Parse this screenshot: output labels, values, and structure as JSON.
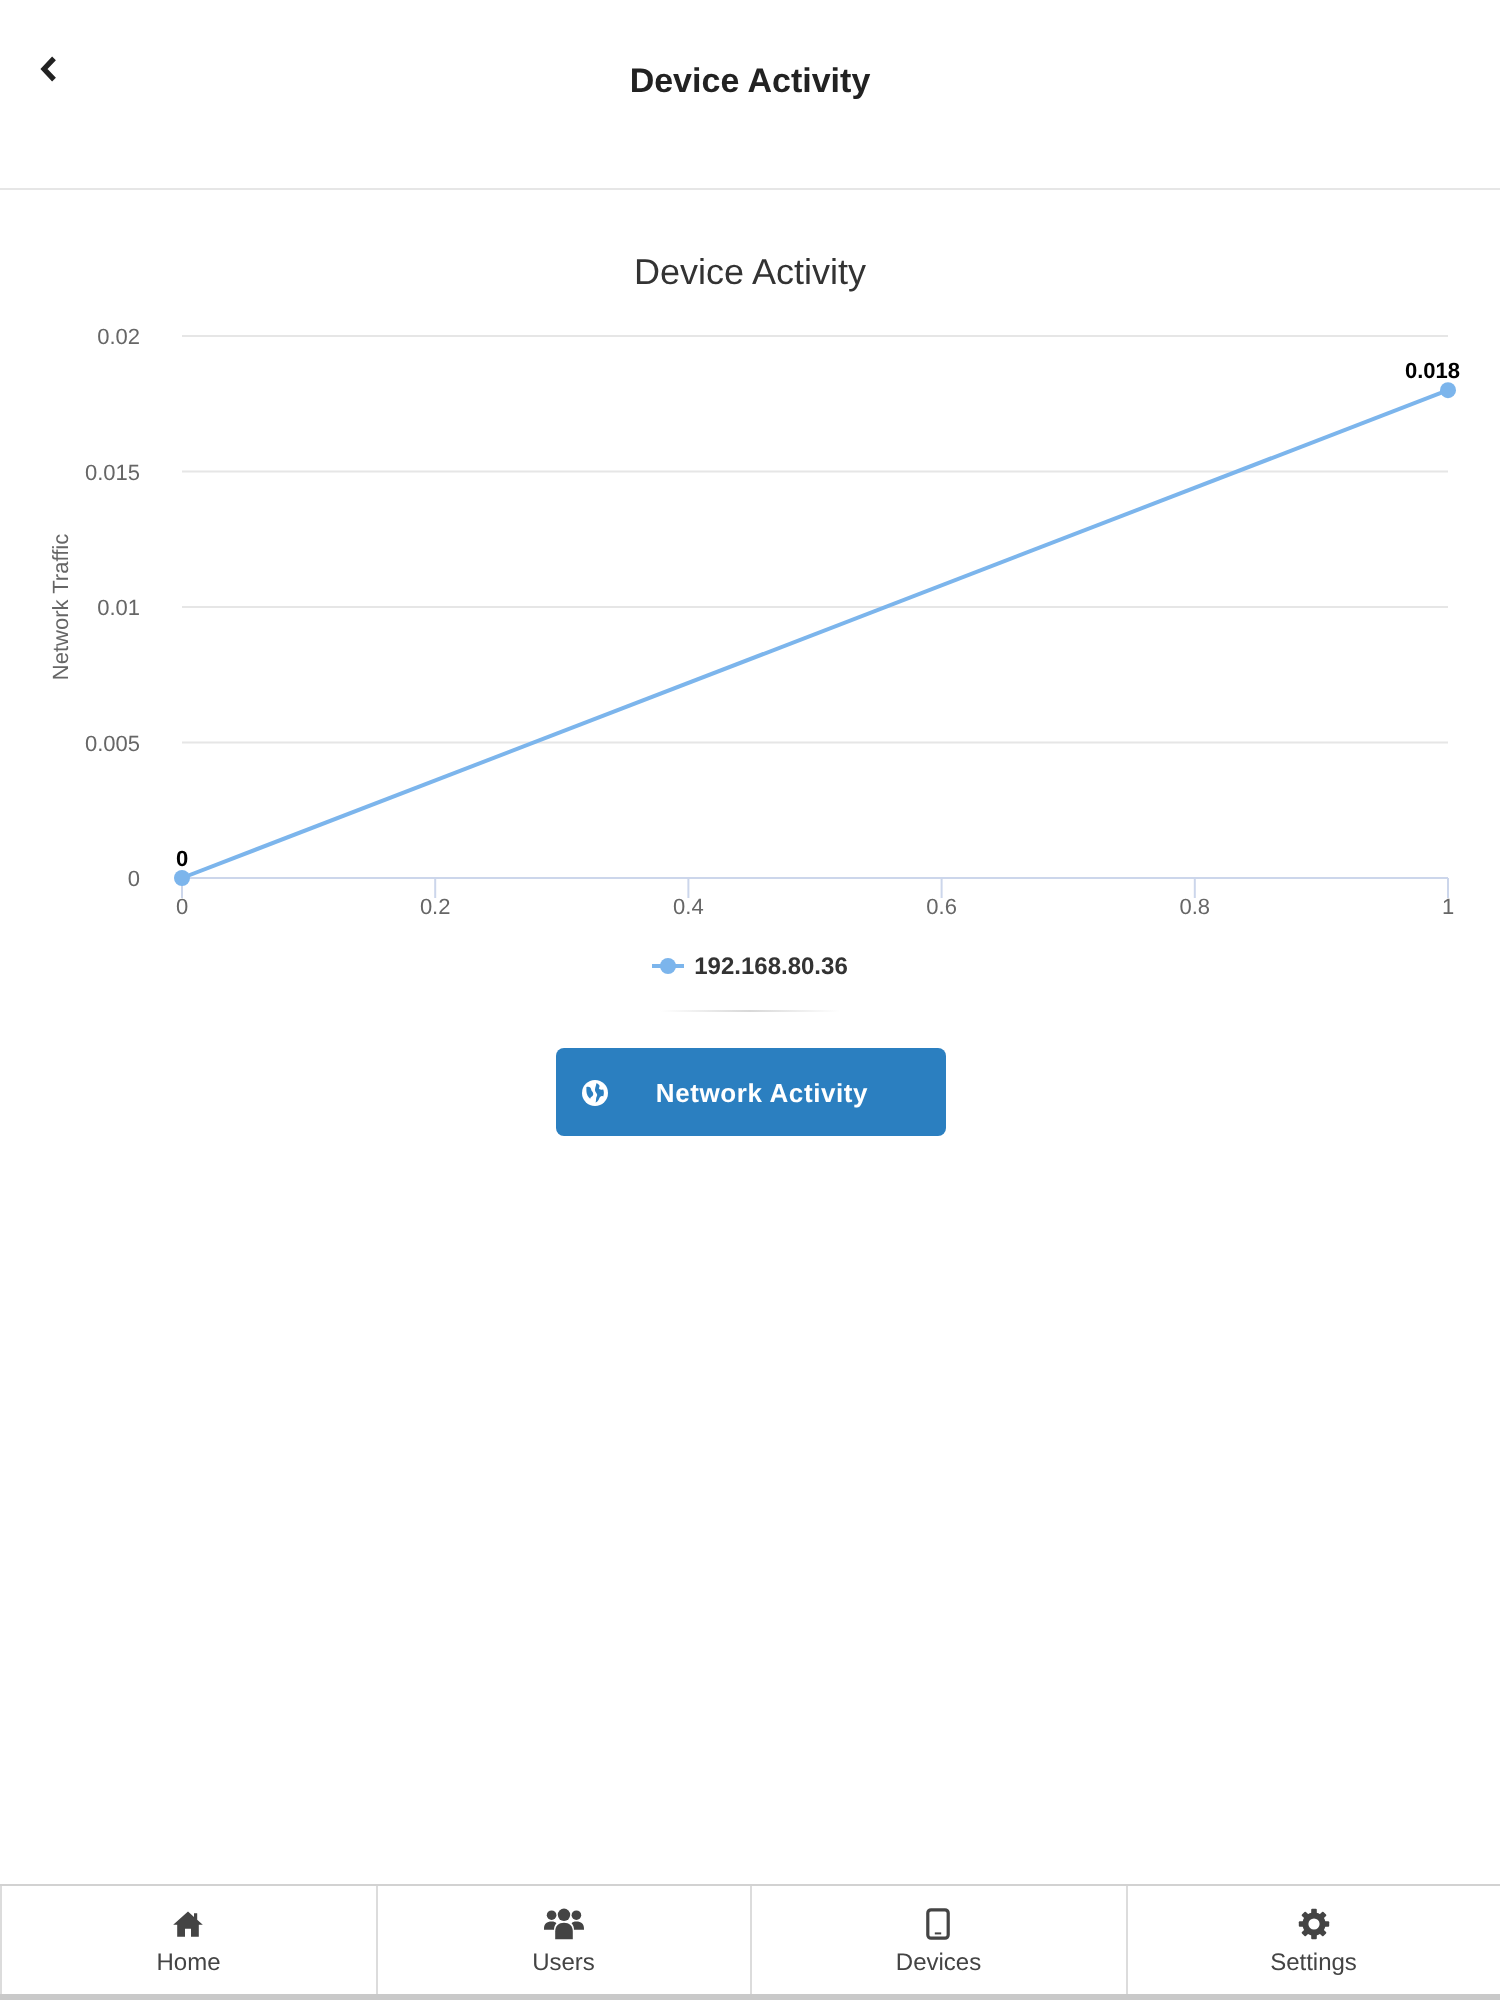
{
  "header": {
    "title": "Device Activity"
  },
  "chart": {
    "chart_data": {
      "type": "line",
      "title": "Device Activity",
      "ylabel": "Network Traffic",
      "x": [
        0,
        1
      ],
      "series": [
        {
          "name": "192.168.80.36",
          "color": "#7cb5ec",
          "values": [
            0,
            0.018
          ],
          "marker": true
        }
      ],
      "xlim": [
        0,
        1
      ],
      "ylim": [
        0,
        0.02
      ],
      "xticks": [
        0,
        0.2,
        0.4,
        0.6,
        0.8,
        1
      ],
      "yticks": [
        0,
        0.005,
        0.01,
        0.015,
        0.02
      ],
      "grid": true,
      "data_labels": true
    }
  },
  "action_button": {
    "label": "Network Activity"
  },
  "tab_bar": {
    "tabs": [
      {
        "label": "Home"
      },
      {
        "label": "Users"
      },
      {
        "label": "Devices"
      },
      {
        "label": "Settings"
      }
    ]
  }
}
